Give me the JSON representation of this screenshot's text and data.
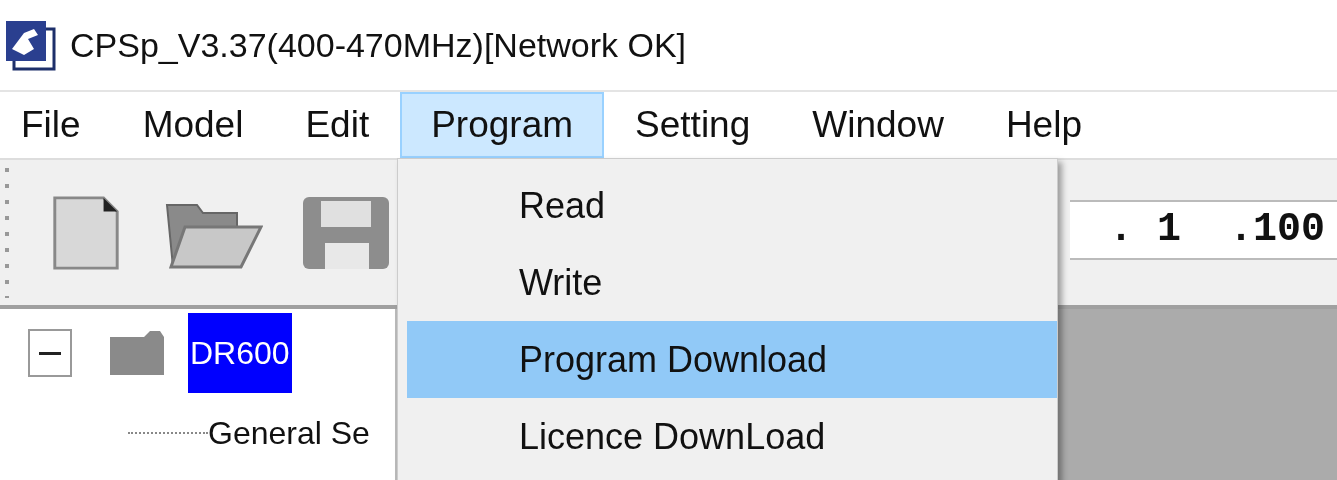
{
  "window": {
    "title": "CPSp_V3.37(400-470MHz)[Network OK]"
  },
  "menu_bar": [
    {
      "label": "File",
      "selected": false
    },
    {
      "label": "Model",
      "selected": false
    },
    {
      "label": "Edit",
      "selected": false
    },
    {
      "label": "Program",
      "selected": true
    },
    {
      "label": "Setting",
      "selected": false
    },
    {
      "label": "Window",
      "selected": false
    },
    {
      "label": "Help",
      "selected": false
    }
  ],
  "program_menu": {
    "items": [
      {
        "label": "Read",
        "selected": false
      },
      {
        "label": "Write",
        "selected": false
      },
      {
        "label": "Program Download",
        "selected": true
      },
      {
        "label": "Licence DownLoad",
        "selected": false
      }
    ]
  },
  "toolbar": {
    "address_field": {
      "value": ". 1  .100"
    }
  },
  "tree": [
    {
      "label": "DR600",
      "selected": true,
      "expanded": true,
      "children": [
        {
          "label": "General Se",
          "selected": false
        }
      ]
    }
  ]
}
